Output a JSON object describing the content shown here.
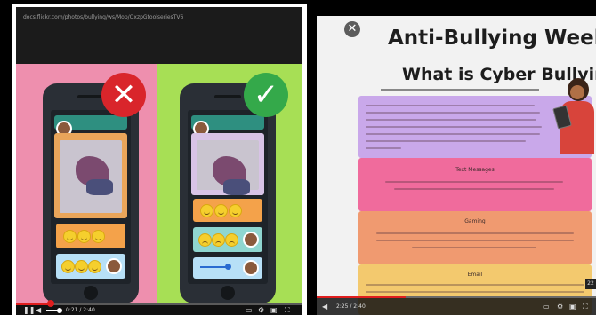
{
  "left_video": {
    "url_text": "docs.flickr.com/photos/bullying/ws/Mop/OxzpGtoolseriesTV6",
    "time": "0:21 / 2:40",
    "progress_fraction": 0.12,
    "volume_fraction": 0.8,
    "panels": {
      "bad": {
        "badge_icon": "x-mark-icon",
        "color": "#d9252b"
      },
      "good": {
        "badge_icon": "check-mark-icon",
        "color": "#34a94a"
      }
    }
  },
  "right_slide": {
    "title": "Anti-Bullying Week",
    "subtitle": "What is Cyber Bullying?",
    "sections": [
      {
        "heading": "",
        "color": "#c9a8ea"
      },
      {
        "heading": "Text Messages",
        "color": "#f06b9c"
      },
      {
        "heading": "Gaming",
        "color": "#f09a70"
      },
      {
        "heading": "Email",
        "color": "#f3c96e"
      }
    ],
    "time": "2:25 / 2:40",
    "progress_fraction": 0.32,
    "edge_label": "22"
  },
  "colors": {
    "pink_bg": "#ee8fae",
    "green_bg": "#a7df55",
    "progress_red": "#e01e1e"
  }
}
